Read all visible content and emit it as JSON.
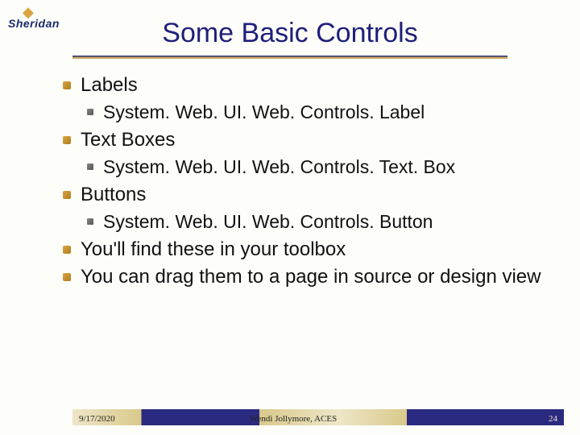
{
  "logo": {
    "name": "Sheridan"
  },
  "title": "Some Basic Controls",
  "bullets": {
    "b0": "Labels",
    "b0s": "System. Web. UI. Web. Controls. Label",
    "b1": "Text Boxes",
    "b1s": "System. Web. UI. Web. Controls. Text. Box",
    "b2": "Buttons",
    "b2s": "System. Web. UI. Web. Controls. Button",
    "b3": "You'll find these in your toolbox",
    "b4": "You can drag them to a page in source or design view"
  },
  "footer": {
    "date": "9/17/2020",
    "author": "Wendi Jollymore, ACES",
    "page": "24"
  }
}
